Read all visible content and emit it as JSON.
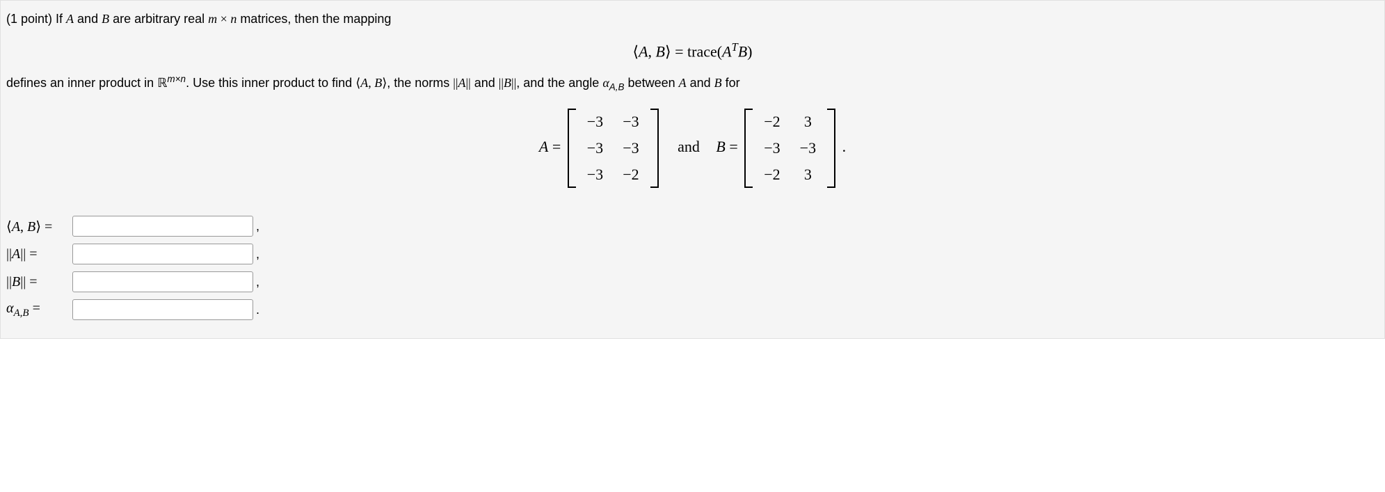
{
  "problem": {
    "points_prefix": "(1 point) If ",
    "intro_text_1": " are arbitrary real ",
    "intro_text_2": " matrices, then the mapping",
    "display_eq": "⟨A, B⟩ = trace(AᵀB)",
    "defines_text_1": "defines an inner product in ",
    "defines_text_2": ". Use this inner product to find ",
    "defines_text_3": ", the norms ",
    "defines_text_4": " and ",
    "defines_text_5": ", and the angle ",
    "defines_text_6": " between ",
    "defines_text_7": " for",
    "matrix_A_label": "A =",
    "matrix_A": [
      [
        "−3",
        "−3"
      ],
      [
        "−3",
        "−3"
      ],
      [
        "−3",
        "−2"
      ]
    ],
    "matrix_and": "and",
    "matrix_B_label": "B =",
    "matrix_B": [
      [
        "−2",
        "3"
      ],
      [
        "−3",
        "−3"
      ],
      [
        "−2",
        "3"
      ]
    ],
    "matrix_end": "."
  },
  "answers": {
    "label_ab": "⟨A, B⟩ =",
    "label_normA": "||A|| =",
    "label_normB": "||B|| =",
    "label_alpha": "α",
    "label_alpha_sub": "A,B",
    "label_alpha_eq": " =",
    "punct_comma": ",",
    "punct_period": "."
  }
}
